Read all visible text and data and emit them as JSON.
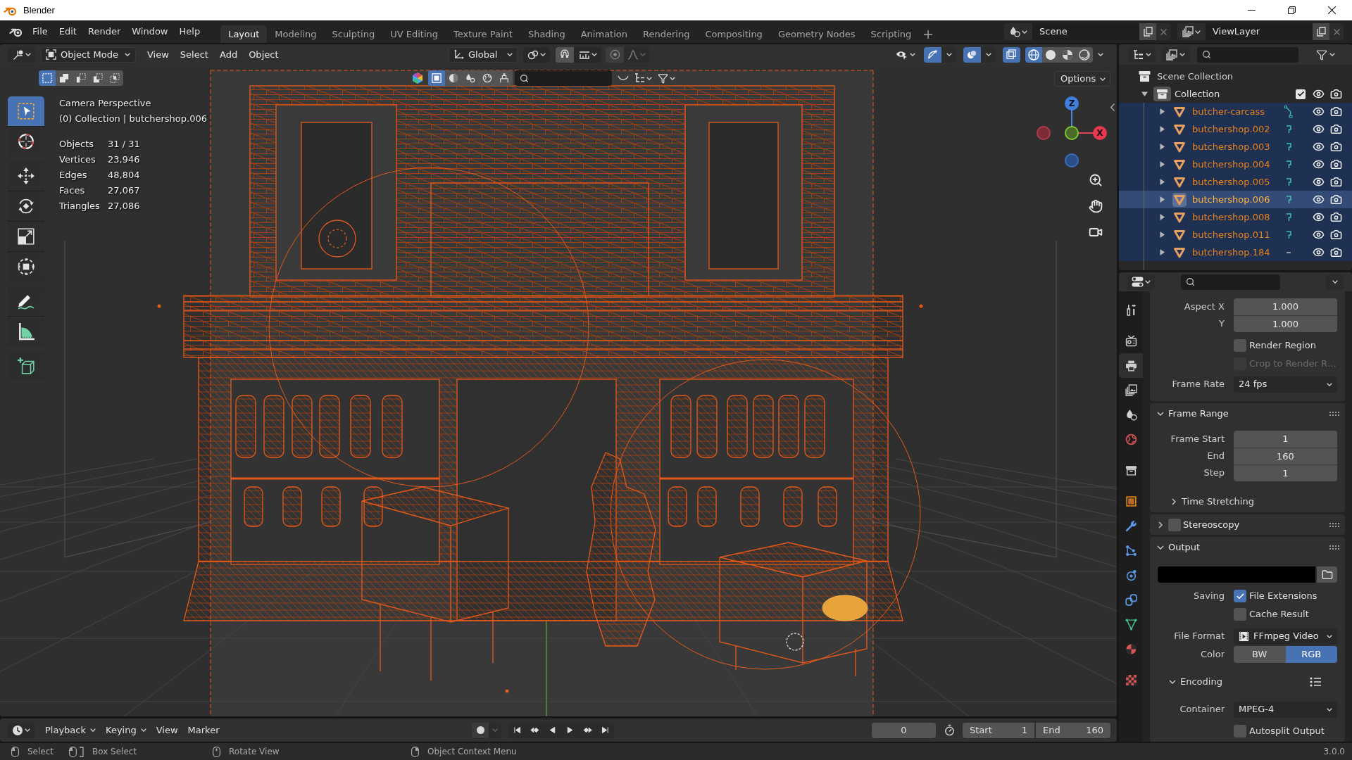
{
  "window": {
    "title": "Blender"
  },
  "menu": [
    "File",
    "Edit",
    "Render",
    "Window",
    "Help"
  ],
  "workspaces": [
    {
      "label": "Layout",
      "selected": true
    },
    {
      "label": "Modeling",
      "selected": false
    },
    {
      "label": "Sculpting",
      "selected": false
    },
    {
      "label": "UV Editing",
      "selected": false
    },
    {
      "label": "Texture Paint",
      "selected": false
    },
    {
      "label": "Shading",
      "selected": false
    },
    {
      "label": "Animation",
      "selected": false
    },
    {
      "label": "Rendering",
      "selected": false
    },
    {
      "label": "Compositing",
      "selected": false
    },
    {
      "label": "Geometry Nodes",
      "selected": false
    },
    {
      "label": "Scripting",
      "selected": false
    }
  ],
  "scene": {
    "name": "Scene"
  },
  "view_layer": {
    "name": "ViewLayer"
  },
  "viewport_header": {
    "mode": "Object Mode",
    "menus": [
      "View",
      "Select",
      "Add",
      "Object"
    ],
    "orientation": "Global",
    "gizmos": true,
    "overlays": true,
    "xray": true,
    "shading": [
      {
        "kind": "wireframe",
        "selected": true
      },
      {
        "kind": "solid",
        "selected": false
      },
      {
        "kind": "material",
        "selected": false
      },
      {
        "kind": "rendered",
        "selected": false
      }
    ]
  },
  "tool_header": {
    "select_modes": [
      {
        "kind": "new",
        "selected": true
      },
      {
        "kind": "extend",
        "selected": false
      },
      {
        "kind": "subtract",
        "selected": false
      },
      {
        "kind": "invert",
        "selected": false
      },
      {
        "kind": "intersect",
        "selected": false
      }
    ],
    "options": "Options"
  },
  "toolbar": [
    {
      "kind": "select-box",
      "selected": true
    },
    {
      "kind": "cursor",
      "selected": false
    },
    {
      "kind": "move",
      "selected": false
    },
    {
      "kind": "rotate",
      "selected": false
    },
    {
      "kind": "scale",
      "selected": false
    },
    {
      "kind": "transform",
      "selected": false
    },
    {
      "kind": "annotate",
      "selected": false
    },
    {
      "kind": "measure",
      "selected": false
    },
    {
      "kind": "add-cube",
      "selected": false
    }
  ],
  "viewport_info": {
    "view": "Camera Perspective",
    "context": "(0) Collection | butchershop.006",
    "stats": [
      {
        "label": "Objects",
        "value": "31 / 31"
      },
      {
        "label": "Vertices",
        "value": "23,946"
      },
      {
        "label": "Edges",
        "value": "48,804"
      },
      {
        "label": "Faces",
        "value": "27,067"
      },
      {
        "label": "Triangles",
        "value": "27,086"
      }
    ]
  },
  "gizmo": {
    "axes": [
      "Z",
      "X"
    ]
  },
  "outliner": {
    "root": "Scene Collection",
    "collections": [
      {
        "name": "Collection",
        "expanded": true,
        "checked": true,
        "children": [
          {
            "name": "butcher-carcass",
            "kind": "armature",
            "expanded": false,
            "selected": true,
            "active": false
          },
          {
            "name": "butchershop.002",
            "kind": "vertex-groups",
            "expanded": false,
            "selected": true,
            "active": false
          },
          {
            "name": "butchershop.003",
            "kind": "vertex-groups",
            "expanded": false,
            "selected": true,
            "active": false
          },
          {
            "name": "butchershop.004",
            "kind": "vertex-groups",
            "expanded": false,
            "selected": true,
            "active": false
          },
          {
            "name": "butchershop.005",
            "kind": "vertex-groups",
            "expanded": false,
            "selected": true,
            "active": false
          },
          {
            "name": "butchershop.006",
            "kind": "vertex-groups",
            "expanded": false,
            "selected": true,
            "active": true
          },
          {
            "name": "butchershop.008",
            "kind": "vertex-groups",
            "expanded": false,
            "selected": true,
            "active": false
          },
          {
            "name": "butchershop.011",
            "kind": "vertex-groups",
            "expanded": false,
            "selected": true,
            "active": false
          },
          {
            "name": "butchershop.184",
            "kind": "other",
            "expanded": false,
            "selected": true,
            "active": false
          }
        ]
      }
    ]
  },
  "properties": {
    "tabs": [
      {
        "kind": "tool",
        "selected": false
      },
      {
        "kind": "render",
        "selected": false
      },
      {
        "kind": "output",
        "selected": true
      },
      {
        "kind": "view-layer",
        "selected": false
      },
      {
        "kind": "scene",
        "selected": false
      },
      {
        "kind": "world",
        "selected": false
      },
      {
        "kind": "collection",
        "selected": false
      },
      {
        "kind": "object",
        "selected": false
      },
      {
        "kind": "modifier",
        "selected": false
      },
      {
        "kind": "particles",
        "selected": false
      },
      {
        "kind": "physics",
        "selected": false
      },
      {
        "kind": "constraints",
        "selected": false
      },
      {
        "kind": "data",
        "selected": false
      },
      {
        "kind": "material",
        "selected": false
      },
      {
        "kind": "texture",
        "selected": false
      }
    ],
    "format": {
      "aspect_x": {
        "label": "Aspect X",
        "value": "1.000"
      },
      "aspect_y": {
        "label": "Y",
        "value": "1.000"
      },
      "render_region": {
        "label": "Render Region",
        "checked": false
      },
      "crop_to_region": {
        "label": "Crop to Render R…",
        "checked": false,
        "disabled": true
      },
      "frame_rate": {
        "label": "Frame Rate",
        "value": "24 fps"
      }
    },
    "frame_range": {
      "title": "Frame Range",
      "expanded": true,
      "fields": [
        {
          "label": "Frame Start",
          "value": "1"
        },
        {
          "label": "End",
          "value": "160"
        },
        {
          "label": "Step",
          "value": "1"
        }
      ],
      "time_stretching": {
        "title": "Time Stretching",
        "expanded": false
      }
    },
    "stereoscopy": {
      "title": "Stereoscopy",
      "expanded": false,
      "checked": false
    },
    "output": {
      "title": "Output",
      "expanded": true,
      "saving_label": "Saving",
      "file_extensions": {
        "label": "File Extensions",
        "checked": true
      },
      "cache_result": {
        "label": "Cache Result",
        "checked": false
      },
      "file_format": {
        "label": "File Format",
        "value": "FFmpeg Video"
      },
      "color": {
        "label": "Color",
        "options": [
          {
            "label": "BW",
            "selected": false
          },
          {
            "label": "RGB",
            "selected": true
          }
        ]
      },
      "encoding": {
        "title": "Encoding",
        "expanded": true,
        "container": {
          "label": "Container",
          "value": "MPEG-4"
        },
        "autosplit": {
          "label": "Autosplit Output",
          "checked": false
        }
      }
    }
  },
  "timeline": {
    "menus": [
      {
        "label": "Playback",
        "kind": "dropdown"
      },
      {
        "label": "Keying",
        "kind": "dropdown"
      },
      {
        "label": "View",
        "kind": "menu"
      },
      {
        "label": "Marker",
        "kind": "menu"
      }
    ],
    "current_frame": "0",
    "start": {
      "label": "Start",
      "value": "1"
    },
    "end": {
      "label": "End",
      "value": "160"
    }
  },
  "status_bar": {
    "hints": [
      {
        "kind": "left-click",
        "label": "Select"
      },
      {
        "kind": "drag",
        "label": "Box Select"
      },
      {
        "kind": "middle-click",
        "label": "Rotate View"
      },
      {
        "kind": "right-click",
        "label": "Object Context Menu"
      }
    ],
    "version": "3.0.0"
  }
}
